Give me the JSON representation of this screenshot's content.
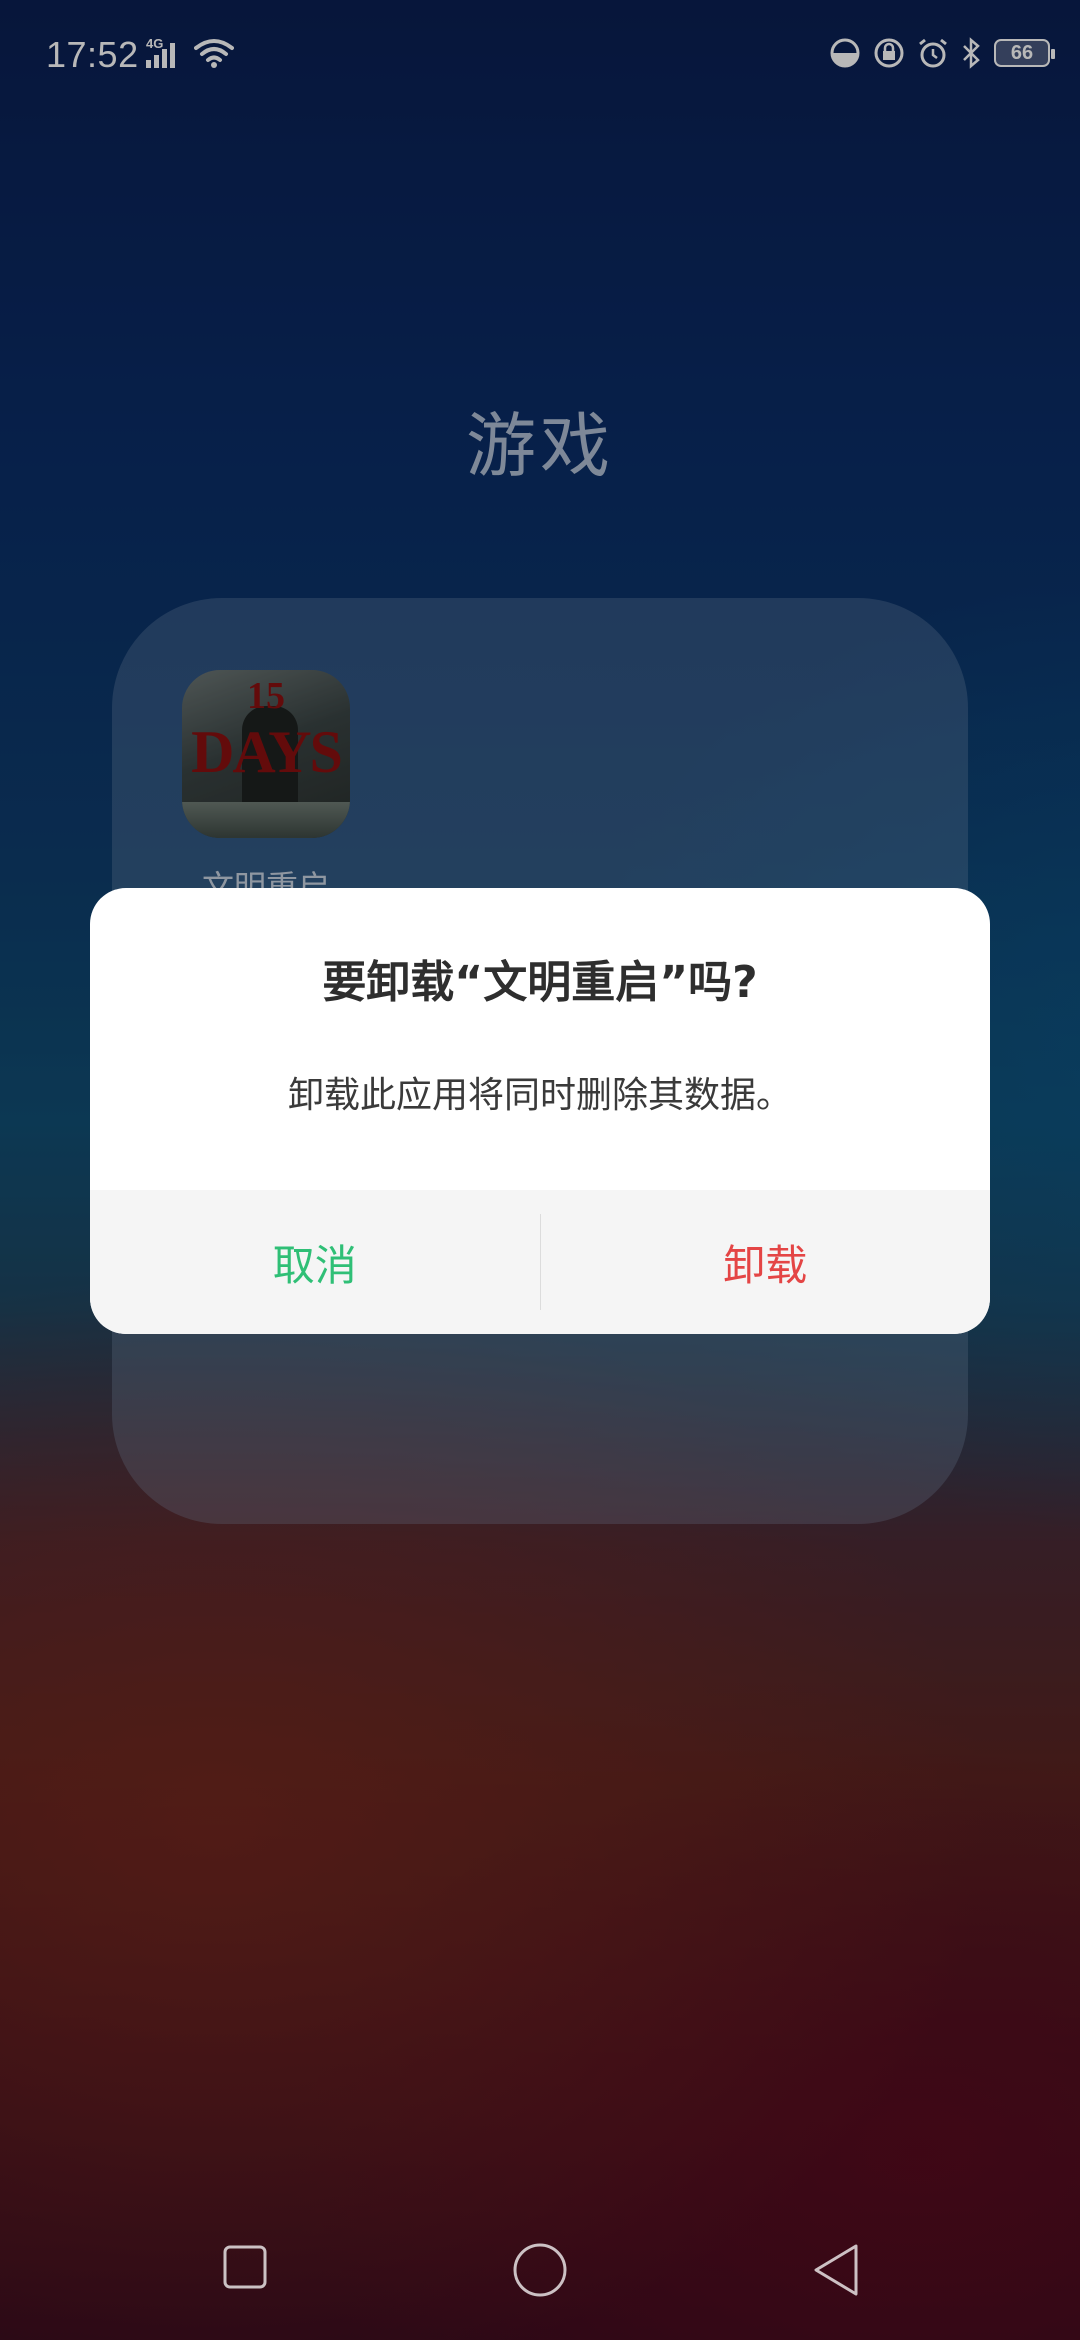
{
  "status_bar": {
    "time": "17:52",
    "network_type": "4G",
    "battery": "66",
    "icons": [
      "data-saver-icon",
      "lock-rotation-icon",
      "alarm-icon",
      "bluetooth-icon",
      "battery-icon"
    ]
  },
  "folder": {
    "title": "游戏",
    "apps": [
      {
        "label": "文明重启",
        "icon_text_top": "15",
        "icon_text_main": "DAYS"
      }
    ]
  },
  "dialog": {
    "title": "要卸载“文明重启”吗?",
    "message": "卸载此应用将同时删除其数据。",
    "cancel_label": "取消",
    "uninstall_label": "卸载",
    "cancel_color": "#2fbf76",
    "uninstall_color": "#e44545"
  },
  "nav_bar": {
    "buttons": [
      "recent-apps",
      "home",
      "back"
    ]
  }
}
